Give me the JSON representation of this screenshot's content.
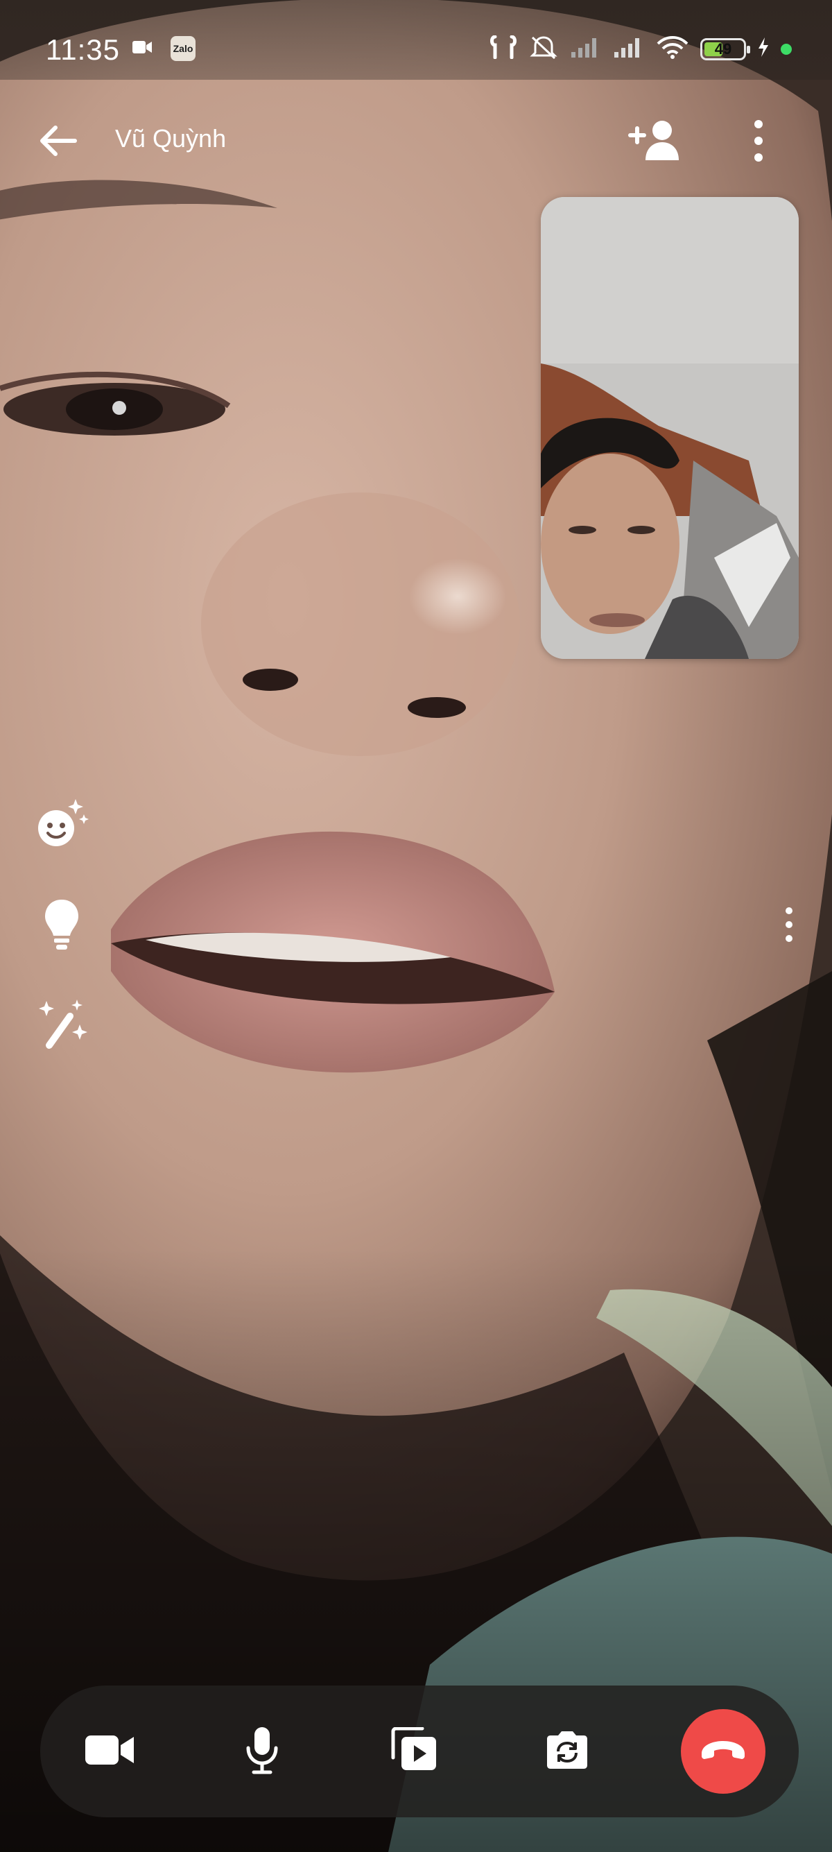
{
  "status_bar": {
    "time": "11:35",
    "left_icons": [
      "video-camera-icon",
      "zalo-app-icon"
    ],
    "zalo_badge_text": "Zalo",
    "right_icons": [
      "earbuds-icon",
      "bell-muted-icon",
      "signal-bars-icon",
      "signal-bars-icon",
      "wifi-icon",
      "battery-icon",
      "charging-bolt-icon"
    ],
    "battery_level": "49",
    "battery_fraction": 0.49,
    "dot_color": "#3ddc66"
  },
  "header": {
    "contact_name": "Vũ Quỳnh",
    "back_icon": "arrow-left-icon",
    "add_person_icon": "add-person-icon",
    "more_icon": "more-vertical-icon"
  },
  "side_tools": [
    {
      "name": "face-effects",
      "icon": "smiley-sparkle-icon"
    },
    {
      "name": "lighting",
      "icon": "lightbulb-icon"
    },
    {
      "name": "beautify",
      "icon": "magic-wand-icon"
    }
  ],
  "controls": {
    "camera_icon": "video-camera-icon",
    "mic_icon": "microphone-icon",
    "share_icon": "media-share-icon",
    "switch_camera_icon": "switch-camera-icon",
    "end_call_icon": "hang-up-icon",
    "end_call_color": "#ef4a48"
  }
}
